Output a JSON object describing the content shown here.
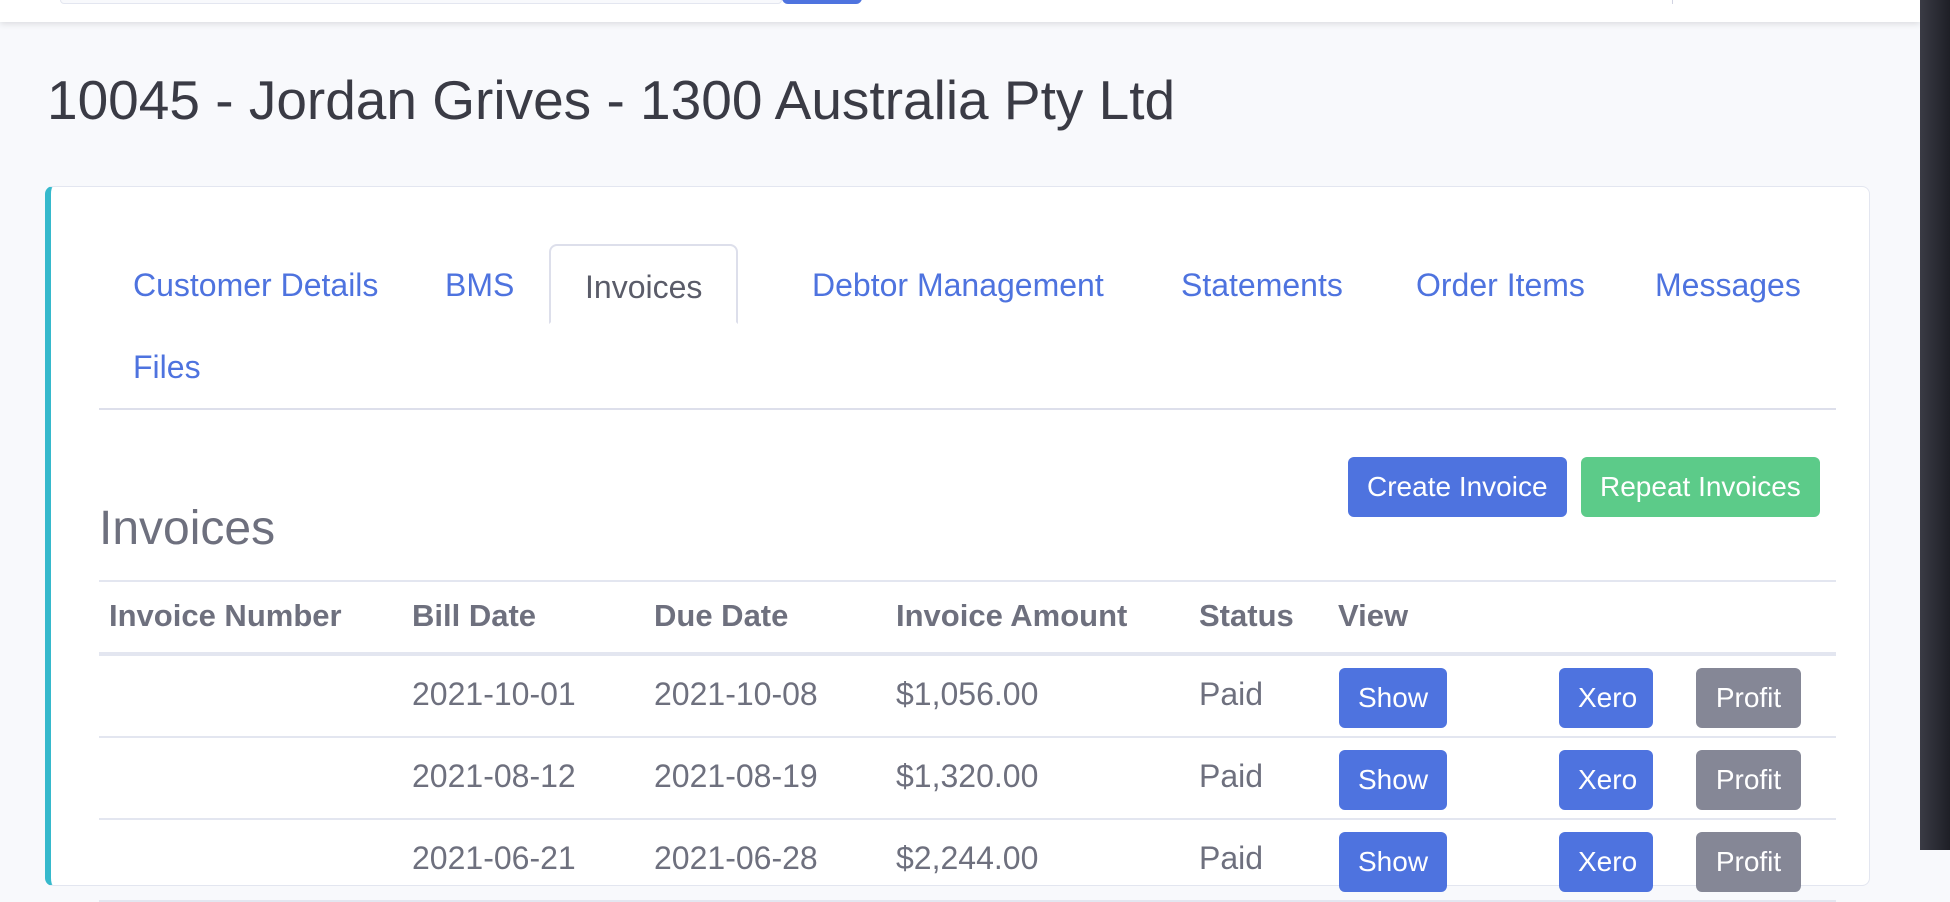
{
  "page": {
    "title": "10045 - Jordan Grives - 1300 Australia Pty Ltd"
  },
  "tabs": [
    {
      "label": "Customer Details"
    },
    {
      "label": "BMS"
    },
    {
      "label": "Invoices"
    },
    {
      "label": "Debtor Management"
    },
    {
      "label": "Statements"
    },
    {
      "label": "Order Items"
    },
    {
      "label": "Messages"
    },
    {
      "label": "Files"
    }
  ],
  "active_tab": "Invoices",
  "invoices": {
    "title": "Invoices",
    "create_label": "Create Invoice",
    "repeat_label": "Repeat Invoices",
    "columns": [
      "Invoice Number",
      "Bill Date",
      "Due Date",
      "Invoice Amount",
      "Status",
      "View"
    ],
    "rows": [
      {
        "invoice_number": "",
        "bill_date": "2021-10-01",
        "due_date": "2021-10-08",
        "amount": "$1,056.00",
        "status": "Paid",
        "show": "Show",
        "xero": "Xero",
        "profit": "Profit"
      },
      {
        "invoice_number": "",
        "bill_date": "2021-08-12",
        "due_date": "2021-08-19",
        "amount": "$1,320.00",
        "status": "Paid",
        "show": "Show",
        "xero": "Xero",
        "profit": "Profit"
      },
      {
        "invoice_number": "",
        "bill_date": "2021-06-21",
        "due_date": "2021-06-28",
        "amount": "$2,244.00",
        "status": "Paid",
        "show": "Show",
        "xero": "Xero",
        "profit": "Profit"
      }
    ]
  },
  "colors": {
    "primary": "#4e73df",
    "success": "#5ccb89",
    "secondary": "#858796",
    "card_accent": "#36b9cc"
  }
}
